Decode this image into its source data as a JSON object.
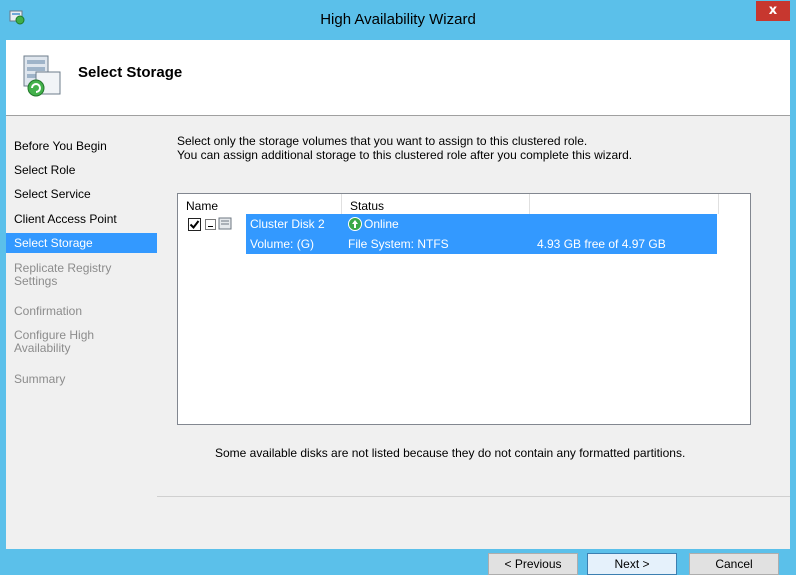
{
  "window": {
    "title": "High Availability Wizard",
    "close_glyph": "x",
    "icon": "cluster-wizard-icon"
  },
  "header": {
    "title": "Select Storage",
    "icon": "storage-wizard-icon"
  },
  "nav": {
    "items": [
      {
        "label": "Before You Begin",
        "state": "done"
      },
      {
        "label": "Select Role",
        "state": "done"
      },
      {
        "label": "Select Service",
        "state": "done"
      },
      {
        "label": "Client Access Point",
        "state": "done"
      },
      {
        "label": "Select Storage",
        "state": "active"
      },
      {
        "label": "Replicate Registry Settings",
        "line1": "Replicate Registry",
        "line2": "Settings",
        "state": "disabled"
      },
      {
        "label": "Confirmation",
        "state": "disabled"
      },
      {
        "label": "Configure High Availability",
        "line1": "Configure High",
        "line2": "Availability",
        "state": "disabled"
      },
      {
        "label": "Summary",
        "state": "disabled"
      }
    ]
  },
  "content": {
    "instruction_line1": "Select only the storage volumes that you want to assign to this clustered role.",
    "instruction_line2": "You can assign additional storage to this clustered role after you complete this wizard.",
    "columns": [
      "Name",
      "Status",
      ""
    ],
    "disk": {
      "checked": true,
      "name": "Cluster Disk 2",
      "status": "Online",
      "volume": "Volume: (G)",
      "filesystem": "File System: NTFS",
      "free": "4.93 GB free of 4.97 GB"
    },
    "note": "Some available disks are not listed because they do not contain any formatted partitions."
  },
  "buttons": {
    "previous": "< Previous",
    "next": "Next >",
    "cancel": "Cancel"
  },
  "colors": {
    "titlebar": "#5bc0ea",
    "selection": "#3399ff",
    "close": "#c7372f"
  }
}
